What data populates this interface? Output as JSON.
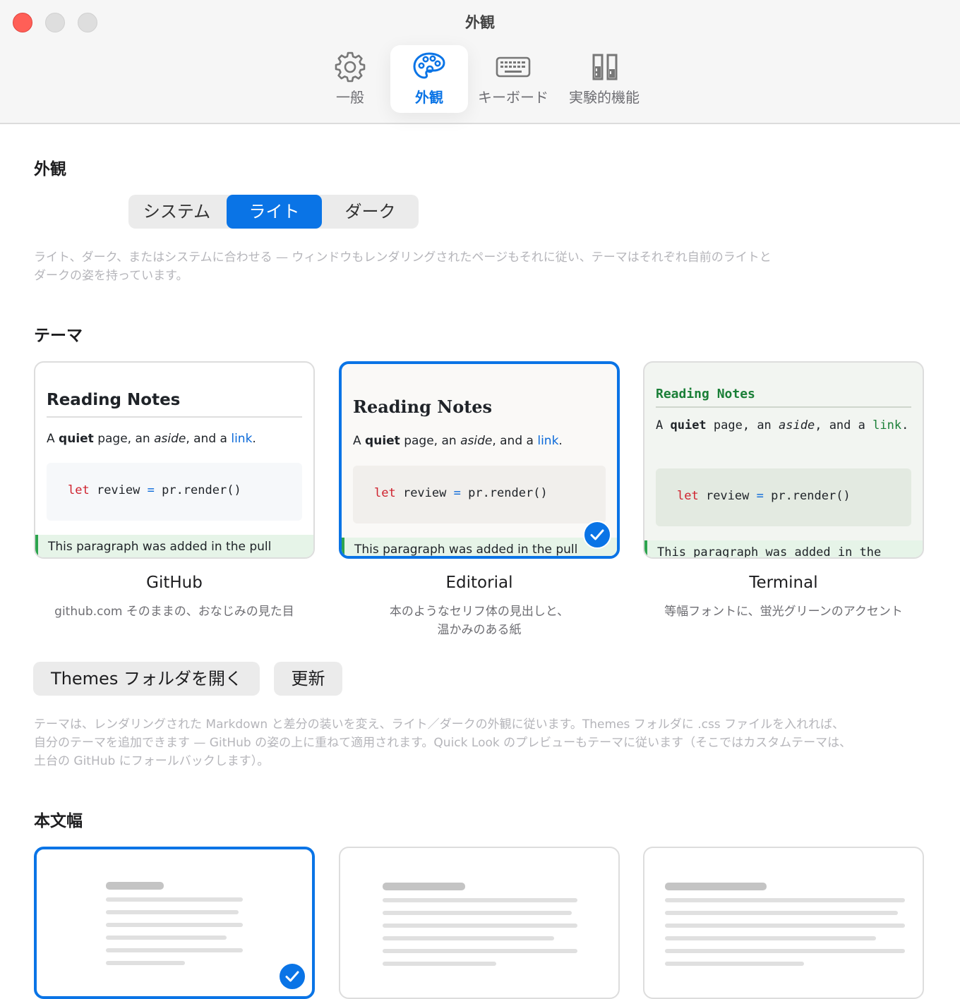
{
  "window": {
    "title": "外観"
  },
  "tabs": [
    {
      "label": "一般",
      "icon": "gear-icon"
    },
    {
      "label": "外観",
      "icon": "palette-icon",
      "active": true
    },
    {
      "label": "キーボード",
      "icon": "keyboard-icon"
    },
    {
      "label": "実験的機能",
      "icon": "test-tubes-icon"
    }
  ],
  "appearance": {
    "heading": "外観",
    "options": [
      "システム",
      "ライト",
      "ダーク"
    ],
    "selected": "ライト",
    "description_line1": "ライト、ダーク、またはシステムに合わせる — ウィンドウもレンダリングされたページもそれに従い、テーマはそれぞれ自前のライトと",
    "description_line2": "ダークの姿を持っています。"
  },
  "themes": {
    "heading": "テーマ",
    "preview": {
      "title": "Reading Notes",
      "p_a": "A ",
      "p_quiet": "quiet",
      "p_mid": " page, an ",
      "p_aside": "aside",
      "p_and": ", and a ",
      "p_link": "link",
      "p_end": ".",
      "code_kw": "let",
      "code_mid": " review ",
      "code_op": "=",
      "code_tail": " pr.render()",
      "diff": "This paragraph was added in the pull"
    },
    "items": [
      {
        "name": "GitHub",
        "desc_line1": "github.com そのままの、おなじみの見た目",
        "desc_line2": ""
      },
      {
        "name": "Editorial",
        "desc_line1": "本のようなセリフ体の見出しと、",
        "desc_line2": "温かみのある紙",
        "selected": true
      },
      {
        "name": "Terminal",
        "desc_line1": "等幅フォントに、蛍光グリーンのアクセント",
        "desc_line2": ""
      }
    ],
    "terminal_diff": "This paragraph was added in the",
    "buttons": {
      "open_folder": "Themes フォルダを開く",
      "refresh": "更新"
    },
    "description_line1": "テーマは、レンダリングされた Markdown と差分の装いを変え、ライト／ダークの外観に従います。Themes フォルダに .css ファイルを入れれば、",
    "description_line2": "自分のテーマを追加できます — GitHub の姿の上に重ねて適用されます。Quick Look のプレビューもテーマに従います（そこではカスタムテーマは、",
    "description_line3": "土台の GitHub にフォールバックします）。"
  },
  "body_width": {
    "heading": "本文幅",
    "options": [
      "narrow",
      "medium",
      "wide"
    ],
    "selected": "narrow"
  },
  "colors": {
    "accent": "#0a74e6",
    "close_button": "#ff5f57",
    "code_keyword": "#cf222e",
    "diff_added_bg": "#e6f4e8",
    "terminal_green": "#1a7f37"
  }
}
